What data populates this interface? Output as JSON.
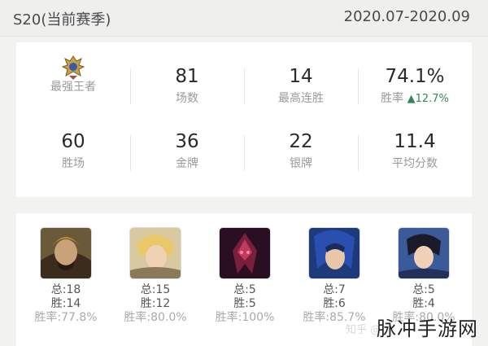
{
  "header": {
    "season": "S20(当前赛季)",
    "date_range": "2020.07-2020.09"
  },
  "stats": [
    {
      "label": "最强王者",
      "icon": "rank-badge-icon"
    },
    {
      "value": "81",
      "label": "场数"
    },
    {
      "value": "14",
      "label": "最高连胜"
    },
    {
      "value": "74.1%",
      "label": "胜率",
      "delta": "▲12.7%"
    },
    {
      "value": "60",
      "label": "胜场"
    },
    {
      "value": "36",
      "label": "金牌"
    },
    {
      "value": "22",
      "label": "银牌"
    },
    {
      "value": "11.4",
      "label": "平均分数"
    }
  ],
  "heroes": [
    {
      "total": "总:18",
      "wins": "胜:14",
      "rate": "胜率:77.8%",
      "icon": "hero-portrait-1"
    },
    {
      "total": "总:15",
      "wins": "胜:12",
      "rate": "胜率:80.0%",
      "icon": "hero-portrait-2"
    },
    {
      "total": "总:5",
      "wins": "胜:5",
      "rate": "胜率:100%",
      "icon": "hero-portrait-3"
    },
    {
      "total": "总:7",
      "wins": "胜:6",
      "rate": "胜率:85.7%",
      "icon": "hero-portrait-4"
    },
    {
      "total": "总:5",
      "wins": "胜:4",
      "rate": "胜率:80.0%",
      "icon": "hero-portrait-5"
    }
  ],
  "watermark": {
    "text": "脉冲手游网",
    "faint": "知乎 @"
  },
  "colors": {
    "delta": "#2e8b57",
    "background": "#f2f2f0",
    "card": "#ffffff"
  }
}
